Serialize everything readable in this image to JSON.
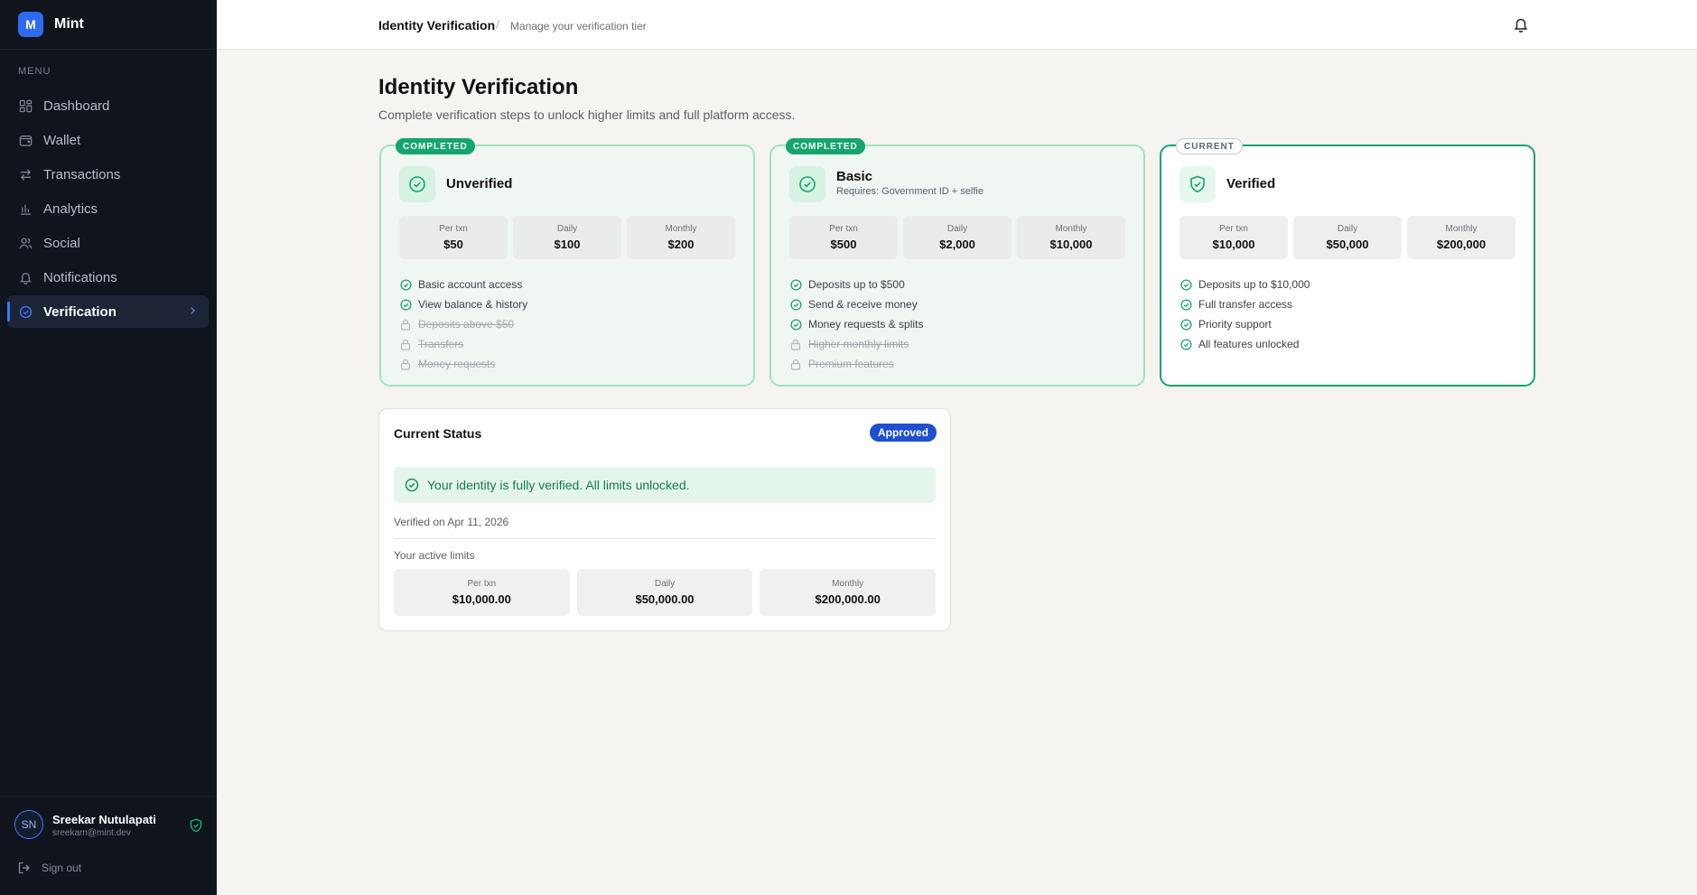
{
  "brand": {
    "logo_letter": "M",
    "name": "Mint"
  },
  "sidebar": {
    "menu_label": "MENU",
    "items": [
      {
        "label": "Dashboard",
        "icon": "grid-icon"
      },
      {
        "label": "Wallet",
        "icon": "wallet-icon"
      },
      {
        "label": "Transactions",
        "icon": "arrows-icon"
      },
      {
        "label": "Analytics",
        "icon": "bar-chart-icon"
      },
      {
        "label": "Social",
        "icon": "users-icon"
      },
      {
        "label": "Notifications",
        "icon": "bell-icon"
      },
      {
        "label": "Verification",
        "icon": "check-circle-icon",
        "active": true
      }
    ]
  },
  "user": {
    "initials": "SN",
    "name": "Sreekar Nutulapati",
    "email": "sreekarn@mint.dev",
    "signout_label": "Sign out"
  },
  "header": {
    "title": "Identity Verification",
    "separator": "/",
    "subtitle": "Manage your verification tier"
  },
  "page": {
    "title": "Identity Verification",
    "subtitle": "Complete verification steps to unlock higher limits and full platform access."
  },
  "tiers": [
    {
      "badge": "COMPLETED",
      "name": "Unverified",
      "requirement": "",
      "limits": [
        {
          "label": "Per txn",
          "value": "$50"
        },
        {
          "label": "Daily",
          "value": "$100"
        },
        {
          "label": "Monthly",
          "value": "$200"
        }
      ],
      "features": [
        {
          "text": "Basic account access",
          "locked": false
        },
        {
          "text": "View balance & history",
          "locked": false
        },
        {
          "text": "Deposits above $50",
          "locked": true
        },
        {
          "text": "Transfers",
          "locked": true
        },
        {
          "text": "Money requests",
          "locked": true
        }
      ]
    },
    {
      "badge": "COMPLETED",
      "name": "Basic",
      "requirement": "Requires: Government ID + selfie",
      "limits": [
        {
          "label": "Per txn",
          "value": "$500"
        },
        {
          "label": "Daily",
          "value": "$2,000"
        },
        {
          "label": "Monthly",
          "value": "$10,000"
        }
      ],
      "features": [
        {
          "text": "Deposits up to $500",
          "locked": false
        },
        {
          "text": "Send & receive money",
          "locked": false
        },
        {
          "text": "Money requests & splits",
          "locked": false
        },
        {
          "text": "Higher monthly limits",
          "locked": true
        },
        {
          "text": "Premium features",
          "locked": true
        }
      ]
    },
    {
      "badge": "CURRENT",
      "name": "Verified",
      "requirement": "",
      "limits": [
        {
          "label": "Per txn",
          "value": "$10,000"
        },
        {
          "label": "Daily",
          "value": "$50,000"
        },
        {
          "label": "Monthly",
          "value": "$200,000"
        }
      ],
      "features": [
        {
          "text": "Deposits up to $10,000",
          "locked": false
        },
        {
          "text": "Full transfer access",
          "locked": false
        },
        {
          "text": "Priority support",
          "locked": false
        },
        {
          "text": "All features unlocked",
          "locked": false
        }
      ]
    }
  ],
  "status": {
    "title": "Current Status",
    "badge": "Approved",
    "message": "Your identity is fully verified. All limits unlocked.",
    "verified_on": "Verified on Apr 11, 2026",
    "active_limits_label": "Your active limits",
    "active_limits": [
      {
        "label": "Per txn",
        "value": "$10,000.00"
      },
      {
        "label": "Daily",
        "value": "$50,000.00"
      },
      {
        "label": "Monthly",
        "value": "$200,000.00"
      }
    ]
  },
  "colors": {
    "accent": "#15a56e",
    "brand_blue": "#2f6bf0",
    "sidebar_bg": "#0f141d",
    "approved_badge": "#1f4fd1"
  }
}
